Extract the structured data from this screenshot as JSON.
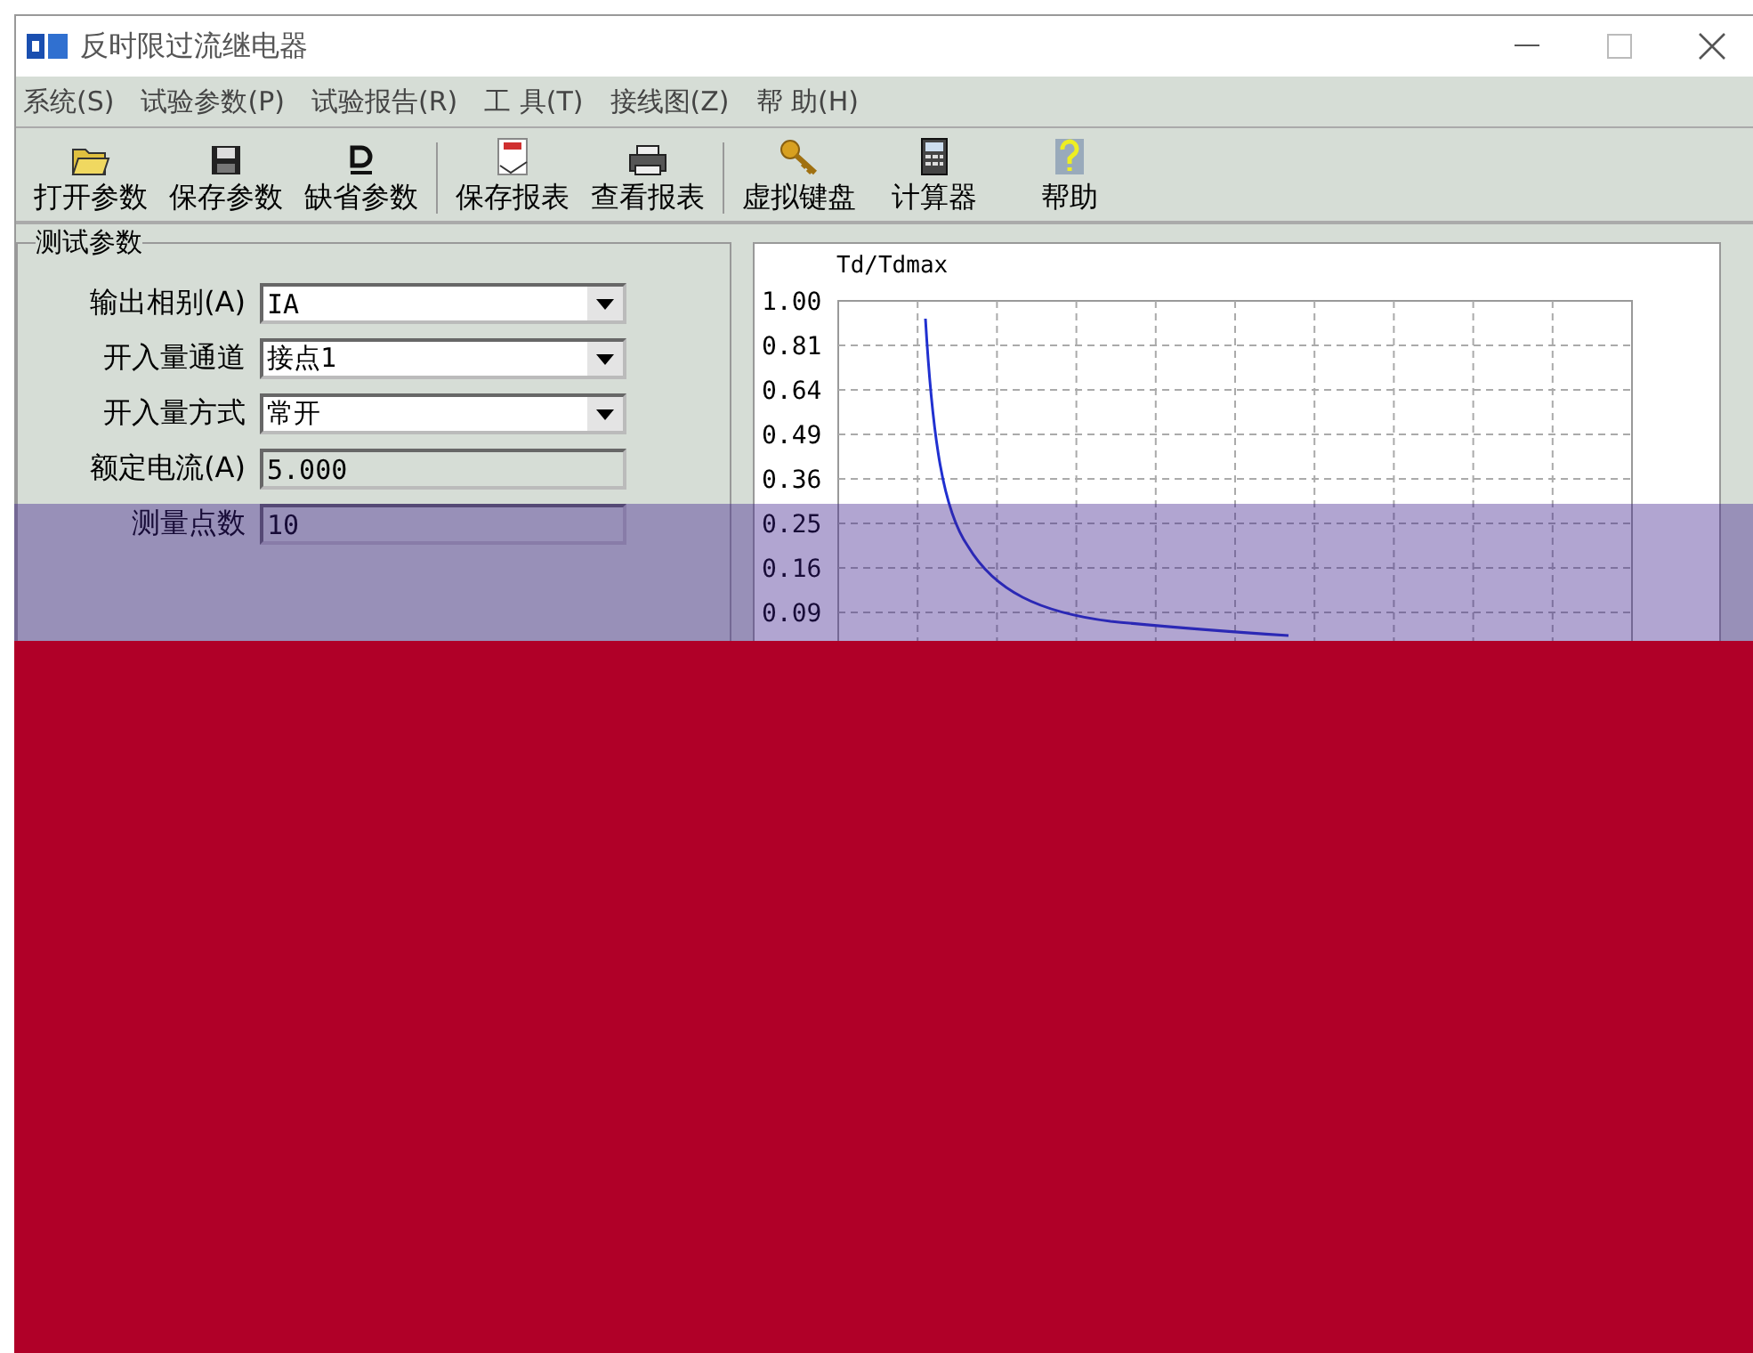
{
  "window": {
    "title": "反时限过流继电器"
  },
  "menu": [
    {
      "label": "系统(S)"
    },
    {
      "label": "试验参数(P)"
    },
    {
      "label": "试验报告(R)"
    },
    {
      "label": "工 具(T)"
    },
    {
      "label": "接线图(Z)"
    },
    {
      "label": "帮 助(H)"
    }
  ],
  "toolbar": [
    {
      "label": "打开参数",
      "separator_before": false
    },
    {
      "label": "保存参数",
      "separator_before": false
    },
    {
      "label": "缺省参数",
      "separator_before": false
    },
    {
      "label": "保存报表",
      "separator_before": true
    },
    {
      "label": "查看报表",
      "separator_before": false
    },
    {
      "label": "虚拟键盘",
      "separator_before": true
    },
    {
      "label": "计算器",
      "separator_before": false
    },
    {
      "label": "帮助",
      "separator_before": false
    }
  ],
  "test_params": {
    "title": "测试参数",
    "fields": [
      {
        "kind": "combo",
        "label": "输出相别(A)",
        "value": "IA"
      },
      {
        "kind": "combo",
        "label": "开入量通道",
        "value": "接点1"
      },
      {
        "kind": "combo",
        "label": "开入量方式",
        "value": "常开"
      },
      {
        "kind": "text",
        "label": "额定电流(A)",
        "value": "5.000"
      },
      {
        "kind": "text",
        "label": "测量点数",
        "value": "10"
      }
    ]
  },
  "curve_panel": {
    "y_axis_label": "Td/Tdmax",
    "y_ticks": [
      "1.00",
      "0.81",
      "0.64",
      "0.49",
      "0.36",
      "0.25",
      "0.16",
      "0.09"
    ]
  }
}
